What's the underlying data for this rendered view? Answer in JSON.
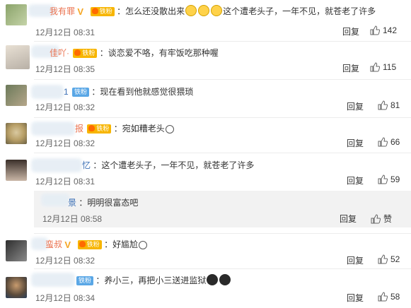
{
  "comments": [
    {
      "name": "我有罪",
      "badges": [
        "v",
        "fan"
      ],
      "text_parts": [
        "：怎么还没散出来",
        "",
        "",
        "",
        "这个遭老头子，一年不见，就苍老了许多"
      ],
      "date": "12月12日 08:31",
      "reply": "回复",
      "likes": "142"
    },
    {
      "name": "佳吖·",
      "badges": [
        "fan"
      ],
      "text": "：谈恋爱不咯，有牢饭吃那种喔",
      "date": "12月12日 08:35",
      "reply": "回复",
      "likes": "115"
    },
    {
      "name": "1",
      "badges": [
        "iron"
      ],
      "text": "：现在看到他就感觉很猥琐",
      "date": "12月12日 08:32",
      "reply": "回复",
      "likes": "81"
    },
    {
      "name": "报",
      "badges": [
        "fan"
      ],
      "text": "：宛如糟老头",
      "date": "12月12日 08:32",
      "reply": "回复",
      "likes": "66"
    },
    {
      "name": "忆",
      "badges": [],
      "text": "：这个遭老头子，一年不见，就苍老了许多",
      "date": "12月12日 08:31",
      "reply": "回复",
      "likes": "59"
    },
    {
      "name": "景",
      "badges": [],
      "text": "：明明很富态吧",
      "date": "12月12日 08:58",
      "reply": "回复",
      "likes": "赞"
    },
    {
      "name": "蛮叔",
      "badges": [
        "v",
        "fan"
      ],
      "text": "：好尴尬",
      "date": "12月12日 08:32",
      "reply": "回复",
      "likes": "52"
    },
    {
      "name": "",
      "badges": [
        "iron"
      ],
      "text": "：养小三，再把小三送进监狱",
      "date": "12月12日 08:34",
      "reply": "回复",
      "likes": "58"
    }
  ],
  "badge_labels": {
    "fan": "铁粉",
    "iron": "铁粉",
    "v": "V"
  },
  "colors": {
    "name": "#eb7350",
    "link": "#3a6fb5",
    "fan": "#f7b500",
    "iron": "#5aa7e6"
  }
}
